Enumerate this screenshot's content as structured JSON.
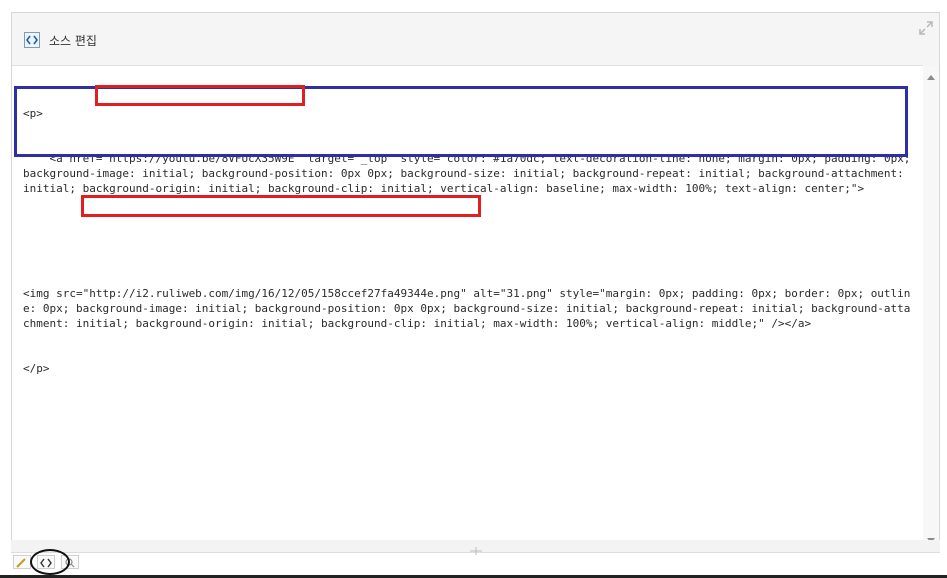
{
  "header": {
    "title": "소스 편집"
  },
  "code": {
    "lines": [
      "<p>",
      "    <a href=\"https://youtu.be/8VFUcX35W9E\" target=\"_top\" style=\"color: #1a70dc; text-decoration-line: none; margin: 0px; padding: 0px; background-image: initial; background-position: 0px 0px; background-size: initial; background-repeat: initial; background-attachment: initial; background-origin: initial; background-clip: initial; vertical-align: baseline; max-width: 100%; text-align: center;\">",
      "",
      "",
      "<img src=\"http://i2.ruliweb.com/img/16/12/05/158ccef27fa49344e.png\" alt=\"31.png\" style=\"margin: 0px; padding: 0px; border: 0px; outline: 0px; background-image: initial; background-position: 0px 0px; background-size: initial; background-repeat: initial; background-attachment: initial; background-origin: initial; background-clip: initial; max-width: 100%; vertical-align: middle;\" /></a>",
      "</p>"
    ]
  },
  "icons": {
    "source_icon": "source-code-icon",
    "resize_icon": "maximize-icon",
    "grip_icon": "resize-grip-icon",
    "edit_icon": "pencil-icon",
    "preview_icon": "magnifier-icon"
  },
  "colors": {
    "annotation_blue": "#2e2ea8",
    "annotation_red": "#e02020",
    "link_color": "#1a70dc"
  }
}
